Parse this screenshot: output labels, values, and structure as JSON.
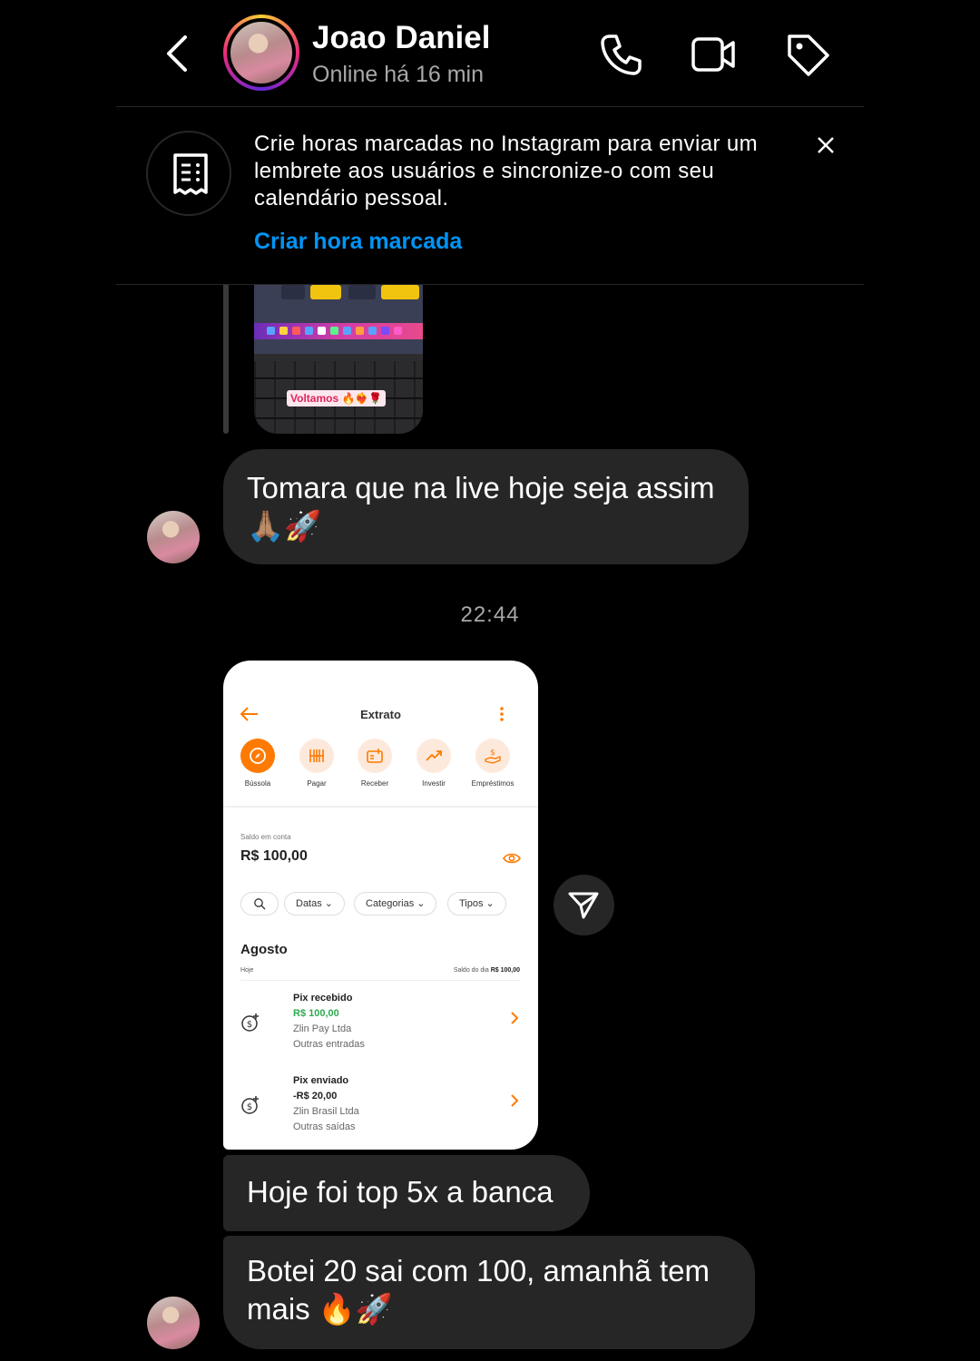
{
  "header": {
    "name": "Joao Daniel",
    "status": "Online há 16 min"
  },
  "banner": {
    "text": "Crie horas marcadas no Instagram para enviar um lembrete aos usuários e sincronize-o com seu calendário pessoal.",
    "link": "Criar hora marcada"
  },
  "thread": {
    "reply_sticker": "Voltamos 🔥❤️‍🔥🌹",
    "message_1": "Tomara que na live hoje seja assim 🙏🏽🚀",
    "timestamp": "22:44",
    "message_2": "Hoje foi top 5x a banca",
    "message_3": "Botei 20 sai com 100, amanhã tem mais 🔥🚀"
  },
  "shared_screenshot": {
    "title": "Extrato",
    "actions": [
      {
        "label": "Bússola",
        "icon": "compass-icon"
      },
      {
        "label": "Pagar",
        "icon": "barcode-icon"
      },
      {
        "label": "Receber",
        "icon": "receive-icon"
      },
      {
        "label": "Investir",
        "icon": "trend-up-icon"
      },
      {
        "label": "Empréstimos",
        "icon": "loan-hand-icon"
      }
    ],
    "balance_label": "Saldo em conta",
    "balance_value": "R$ 100,00",
    "filters": [
      "Datas",
      "Categorias",
      "Tipos"
    ],
    "month": "Agosto",
    "day_label": "Hoje",
    "day_balance_label": "Saldo do dia",
    "day_balance_value": "R$ 100,00",
    "transactions": [
      {
        "title": "Pix recebido",
        "amount": "R$ 100,00",
        "party": "Zlin Pay Ltda",
        "category": "Outras entradas",
        "amount_color": "#2eaa4f"
      },
      {
        "title": "Pix enviado",
        "amount": "-R$ 20,00",
        "party": "Zlin Brasil Ltda",
        "category": "Outras saídas",
        "amount_color": "#222222"
      }
    ]
  },
  "colors": {
    "accent_link": "#0095f6",
    "bubble": "#262626",
    "bank_orange": "#ff7a00"
  }
}
